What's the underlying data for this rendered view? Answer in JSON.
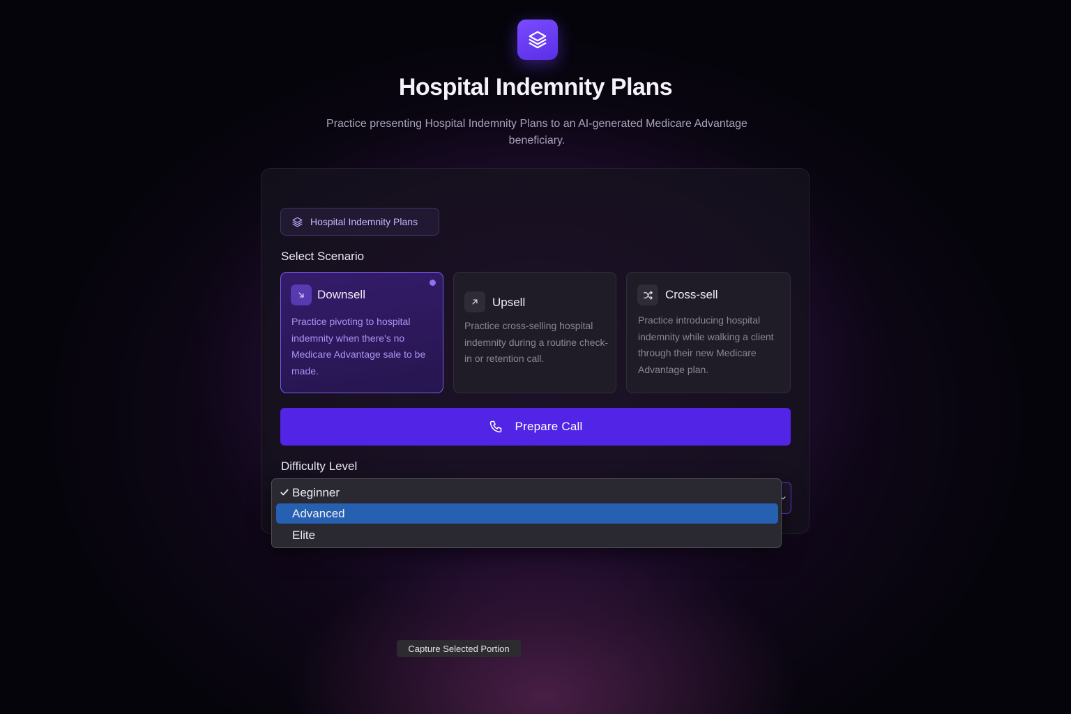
{
  "header": {
    "logo_icon": "layers-icon",
    "title": "Hospital Indemnity Plans",
    "subtitle": "Practice presenting Hospital Indemnity Plans to an AI-generated Medicare Advantage beneficiary."
  },
  "badge": {
    "icon": "layers-icon",
    "label": "Hospital Indemnity Plans"
  },
  "scenario": {
    "label": "Select Scenario",
    "selected": "Downsell",
    "cards": [
      {
        "title": "Downsell",
        "icon": "arrow-down-right-icon",
        "description": "Practice pivoting to hospital indemnity when there's no Medicare Advantage sale to be made."
      },
      {
        "title": "Upsell",
        "icon": "arrow-up-right-icon",
        "description": "Practice cross-selling hospital indemnity during a routine check-in or retention call."
      },
      {
        "title": "Cross-sell",
        "icon": "shuffle-icon",
        "description": "Practice introducing hospital indemnity while walking a client through their new Medicare Advantage plan."
      }
    ]
  },
  "prepare_button": {
    "icon": "phone-icon",
    "label": "Prepare Call"
  },
  "difficulty": {
    "label": "Difficulty Level",
    "selected": "Beginner",
    "highlighted": "Advanced",
    "options": [
      "Beginner",
      "Advanced",
      "Elite"
    ]
  },
  "tooltip": {
    "label": "Capture Selected Portion"
  },
  "colors": {
    "accent": "#5225e6",
    "selected_card_border": "#7b5cf0",
    "dropdown_highlight": "#2660b0"
  }
}
